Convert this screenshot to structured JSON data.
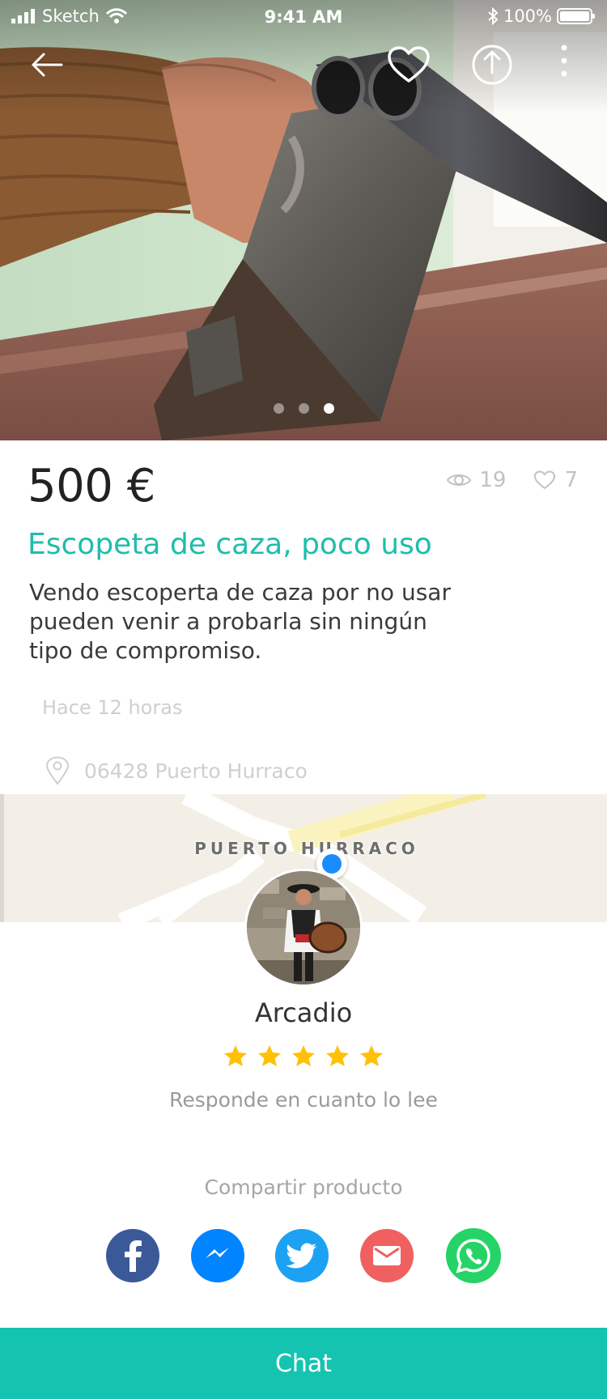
{
  "status_bar": {
    "carrier": "Sketch",
    "time": "9:41 AM",
    "battery": "100%"
  },
  "nav": {
    "back_icon": "arrow-left-icon",
    "favorite_icon": "heart-outline-icon",
    "share_icon": "share-upload-icon",
    "more_icon": "more-vertical-icon"
  },
  "gallery": {
    "photo": "double-barrel shotgun held in hand",
    "page_count": 3,
    "active_index": 2
  },
  "product": {
    "price": "500 €",
    "views": "19",
    "likes": "7",
    "title": "Escopeta de caza, poco uso",
    "description_lines": [
      "Vendo escoperta de caza por no usar",
      "pueden venir a probarla sin ningún",
      "tipo de compromiso."
    ],
    "posted": "Hace 12 horas",
    "location": "06428 Puerto Hurraco"
  },
  "map": {
    "label": "PUERTO HURRACO"
  },
  "seller": {
    "name": "Arcadio",
    "rating": 5,
    "rating_max": 5,
    "response": "Responde en cuanto lo lee"
  },
  "share": {
    "label": "Compartir producto",
    "buttons": [
      {
        "name": "facebook",
        "icon": "facebook-icon",
        "color": "#3b5998"
      },
      {
        "name": "messenger",
        "icon": "messenger-icon",
        "color": "#0084ff"
      },
      {
        "name": "twitter",
        "icon": "twitter-icon",
        "color": "#1da1f2"
      },
      {
        "name": "email",
        "icon": "email-icon",
        "color": "#f06060"
      },
      {
        "name": "whatsapp",
        "icon": "whatsapp-icon",
        "color": "#25d366"
      }
    ]
  },
  "chat": {
    "label": "Chat"
  },
  "colors": {
    "accent": "#14c4b0",
    "title": "#1fbdab",
    "star": "#ffc107"
  }
}
